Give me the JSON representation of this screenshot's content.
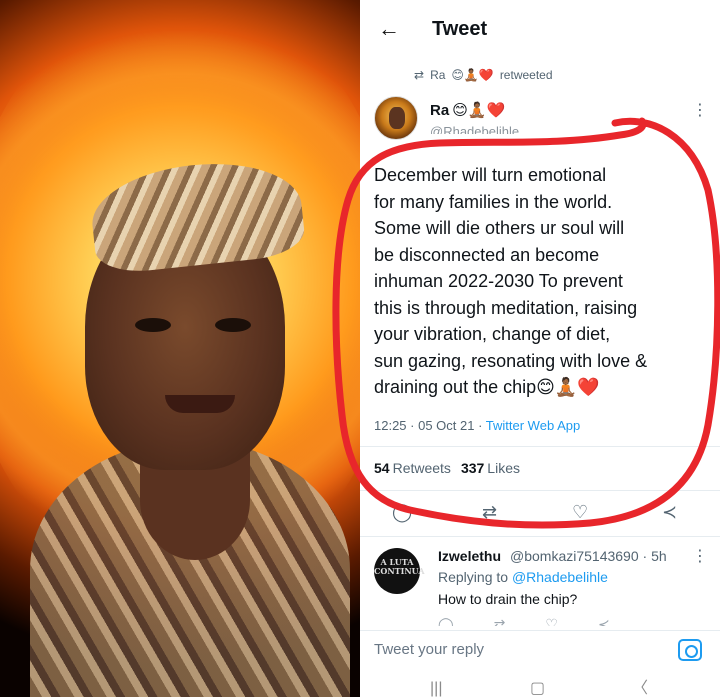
{
  "header": {
    "title": "Tweet"
  },
  "retweet": {
    "name": "Ra",
    "emojis": "😊🧘🏾❤️",
    "label": "retweeted"
  },
  "tweet": {
    "author_name": "Ra",
    "author_emojis": "😊🧘🏾❤️",
    "author_handle": "@Rhadebelihle",
    "text": "December will turn emotional\nfor many families in the world.\nSome will die others ur soul will\nbe disconnected an become\ninhuman 2022-2030 To prevent\nthis is through meditation, raising\nyour vibration, change of diet,\nsun gazing, resonating with love &\ndraining out the chip😊🧘🏾❤️",
    "time": "12:25 · 05 Oct 21 · ",
    "source": "Twitter Web App",
    "retweets_count": "54",
    "retweets_label": "Retweets",
    "likes_count": "337",
    "likes_label": "Likes"
  },
  "reply": {
    "avatar_text": "A LUTA CONTINUA",
    "name": "Izwelethu",
    "handle": "@bomkazi75143690 · 5h",
    "replying_prefix": "Replying to ",
    "replying_to": "@Rhadebelihle",
    "text": "How to drain the chip?"
  },
  "reply_box": {
    "placeholder": "Tweet your reply"
  },
  "icons": {
    "back": "arrow-left",
    "retweet": "retweet",
    "reply": "comment",
    "like": "heart",
    "share": "share",
    "camera": "camera"
  },
  "colors": {
    "accent": "#1d9bf0",
    "annotation": "#e8262b",
    "text": "#0f1419",
    "secondary": "#536471"
  }
}
